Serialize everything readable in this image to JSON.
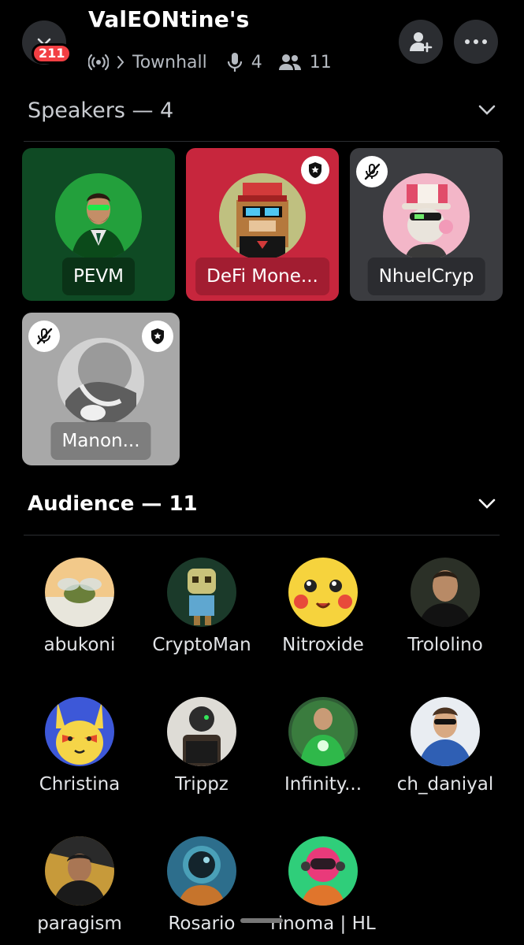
{
  "header": {
    "title": "ValEONtine's",
    "badge_count": "211",
    "channel_name": "Townhall",
    "speaker_count": "4",
    "listener_count": "11",
    "icons": {
      "back": "chevron-down-icon",
      "stage": "stage-icon",
      "breadcrumb": "chevron-right-icon",
      "mic": "microphone-icon",
      "people": "people-icon",
      "add": "add-friend-icon",
      "more": "more-icon"
    }
  },
  "speakers": {
    "heading": "Speakers — 4",
    "items": [
      {
        "name": "PEVM",
        "tile_color": "#0f4a24",
        "muted": false,
        "moderator": false
      },
      {
        "name": "DeFi Mone...",
        "tile_color": "#c7263d",
        "muted": false,
        "moderator": true
      },
      {
        "name": "NhuelCryp",
        "tile_color": "#3b3c40",
        "muted": true,
        "moderator": false
      },
      {
        "name": "Manon...",
        "tile_color": "#a8a8a8",
        "muted": true,
        "moderator": true
      }
    ]
  },
  "audience": {
    "heading": "Audience — 11",
    "items": [
      {
        "name": "abukoni"
      },
      {
        "name": "CryptoMan"
      },
      {
        "name": "Nitroxide"
      },
      {
        "name": "Trololino"
      },
      {
        "name": "Christina"
      },
      {
        "name": "Trippz"
      },
      {
        "name": "Infinity..."
      },
      {
        "name": "ch_daniyal"
      },
      {
        "name": "paragism"
      },
      {
        "name": "Rosario"
      },
      {
        "name": "rinoma | HL"
      }
    ]
  },
  "colors": {
    "background": "#000000",
    "surface": "#2b2d31",
    "badge": "#f23f43",
    "muted_text": "#b5bac1"
  }
}
